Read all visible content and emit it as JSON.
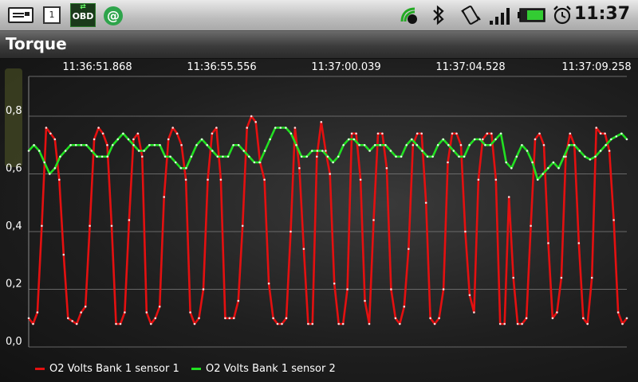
{
  "status_bar": {
    "icons_left": [
      "mail-icon",
      "calendar-icon",
      "obd-icon",
      "at-icon"
    ],
    "calendar_day": "1",
    "obd_label": "OBD",
    "at_symbol": "@",
    "icons_right": [
      "phone-signal-icon",
      "bluetooth-icon",
      "vibrate-icon",
      "signal-bars-icon",
      "battery-icon",
      "alarm-clock-icon"
    ],
    "time": "11:37"
  },
  "app": {
    "title": "Torque"
  },
  "colors": {
    "series1": "#e41010",
    "series2": "#22e022",
    "grid": "#7a7a7a"
  },
  "chart_data": {
    "type": "line",
    "title": "",
    "x_tick_labels": [
      "11:36:51.868",
      "11:36:55.556",
      "11:37:00.039",
      "11:37:04.528",
      "11:37:09.258"
    ],
    "y_tick_labels": [
      "0,0",
      "0,2",
      "0,4",
      "0,6",
      "0,8"
    ],
    "ylim": [
      0,
      0.9
    ],
    "grid": true,
    "legend": "bottom-left",
    "series": [
      {
        "name": "O2 Volts Bank 1 sensor 1",
        "values": [
          0.1,
          0.08,
          0.12,
          0.42,
          0.76,
          0.74,
          0.72,
          0.58,
          0.32,
          0.1,
          0.09,
          0.08,
          0.12,
          0.14,
          0.42,
          0.72,
          0.76,
          0.74,
          0.7,
          0.42,
          0.08,
          0.08,
          0.12,
          0.44,
          0.72,
          0.74,
          0.66,
          0.12,
          0.08,
          0.1,
          0.14,
          0.52,
          0.72,
          0.76,
          0.74,
          0.7,
          0.58,
          0.12,
          0.08,
          0.1,
          0.2,
          0.58,
          0.74,
          0.76,
          0.58,
          0.1,
          0.1,
          0.1,
          0.16,
          0.42,
          0.76,
          0.8,
          0.78,
          0.64,
          0.58,
          0.22,
          0.1,
          0.08,
          0.08,
          0.1,
          0.4,
          0.76,
          0.62,
          0.34,
          0.08,
          0.08,
          0.66,
          0.78,
          0.68,
          0.6,
          0.22,
          0.08,
          0.08,
          0.2,
          0.74,
          0.74,
          0.58,
          0.16,
          0.08,
          0.44,
          0.74,
          0.74,
          0.62,
          0.2,
          0.1,
          0.08,
          0.14,
          0.34,
          0.7,
          0.74,
          0.74,
          0.5,
          0.1,
          0.08,
          0.1,
          0.2,
          0.64,
          0.74,
          0.74,
          0.7,
          0.4,
          0.18,
          0.12,
          0.58,
          0.72,
          0.74,
          0.74,
          0.58,
          0.08,
          0.08,
          0.52,
          0.24,
          0.08,
          0.08,
          0.1,
          0.42,
          0.72,
          0.74,
          0.7,
          0.36,
          0.1,
          0.12,
          0.24,
          0.66,
          0.74,
          0.7,
          0.36,
          0.1,
          0.08,
          0.24,
          0.76,
          0.74,
          0.74,
          0.68,
          0.44,
          0.12,
          0.08,
          0.1
        ]
      },
      {
        "name": "O2 Volts Bank 1 sensor 2",
        "values": [
          0.68,
          0.7,
          0.68,
          0.64,
          0.6,
          0.62,
          0.66,
          0.68,
          0.7,
          0.7,
          0.7,
          0.7,
          0.68,
          0.66,
          0.66,
          0.66,
          0.7,
          0.72,
          0.74,
          0.72,
          0.7,
          0.68,
          0.68,
          0.7,
          0.7,
          0.7,
          0.66,
          0.66,
          0.64,
          0.62,
          0.62,
          0.66,
          0.7,
          0.72,
          0.7,
          0.68,
          0.66,
          0.66,
          0.66,
          0.7,
          0.7,
          0.68,
          0.66,
          0.64,
          0.64,
          0.68,
          0.72,
          0.76,
          0.76,
          0.76,
          0.74,
          0.7,
          0.66,
          0.66,
          0.68,
          0.68,
          0.68,
          0.66,
          0.64,
          0.66,
          0.7,
          0.72,
          0.72,
          0.7,
          0.7,
          0.68,
          0.7,
          0.7,
          0.7,
          0.68,
          0.66,
          0.66,
          0.7,
          0.72,
          0.7,
          0.68,
          0.66,
          0.66,
          0.7,
          0.72,
          0.7,
          0.68,
          0.66,
          0.66,
          0.7,
          0.72,
          0.72,
          0.7,
          0.7,
          0.72,
          0.74,
          0.64,
          0.62,
          0.66,
          0.7,
          0.68,
          0.64,
          0.58,
          0.6,
          0.62,
          0.64,
          0.62,
          0.66,
          0.7,
          0.7,
          0.68,
          0.66,
          0.65,
          0.66,
          0.68,
          0.7,
          0.72,
          0.73,
          0.74,
          0.72
        ]
      }
    ]
  }
}
